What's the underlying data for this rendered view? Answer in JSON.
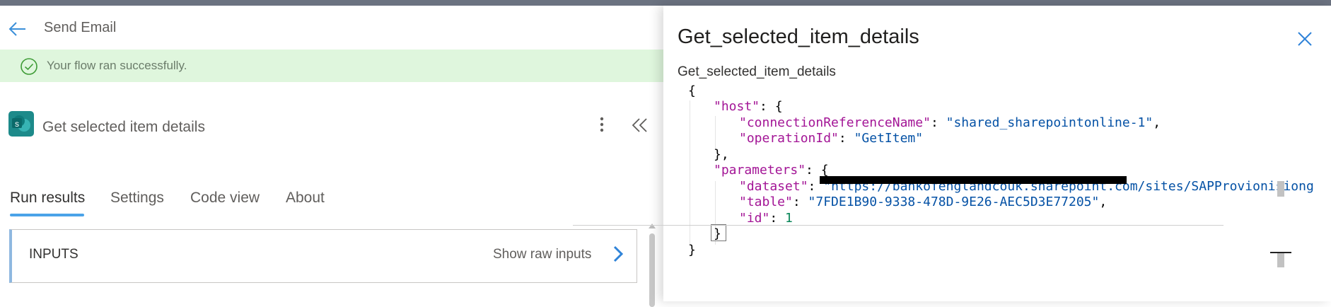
{
  "header": {
    "back_icon": "arrow-left-icon",
    "title": "Send Email"
  },
  "banner": {
    "icon": "check-circle-icon",
    "text": "Your flow ran successfully."
  },
  "step": {
    "icon": "sharepoint-icon",
    "title": "Get selected item details",
    "more_icon": "more-vertical-icon",
    "collapse_icon": "double-chevron-left-icon"
  },
  "tabs": [
    {
      "label": "Run results",
      "active": true
    },
    {
      "label": "Settings",
      "active": false
    },
    {
      "label": "Code view",
      "active": false
    },
    {
      "label": "About",
      "active": false
    }
  ],
  "inputs_section": {
    "label": "INPUTS",
    "raw_link": "Show raw inputs",
    "chevron_icon": "chevron-right-icon"
  },
  "panel": {
    "title": "Get_selected_item_details",
    "subtitle": "Get_selected_item_details",
    "close_icon": "close-icon"
  },
  "code": {
    "l1": "{",
    "host_key": "\"host\"",
    "host_open": ": {",
    "conn_key": "\"connectionReferenceName\"",
    "conn_sep": ": ",
    "conn_val": "\"shared_sharepointonline-1\"",
    "conn_comma": ",",
    "op_key": "\"operationId\"",
    "op_sep": ": ",
    "op_val": "\"GetItem\"",
    "host_close": "},",
    "params_key": "\"parameters\"",
    "params_open": ": {",
    "dataset_key": "\"dataset\"",
    "dataset_sep": ": ",
    "dataset_val": "\"https://bankofenglandcouk.sharepoint.com/sites/SAPProvionisiong",
    "table_key": "\"table\"",
    "table_sep": ": ",
    "table_val": "\"7FDE1B90-9338-478D-9E26-AEC5D3E77205\"",
    "table_comma": ",",
    "id_key": "\"id\"",
    "id_sep": ": ",
    "id_val": "1",
    "params_close": "}",
    "last": "}"
  }
}
